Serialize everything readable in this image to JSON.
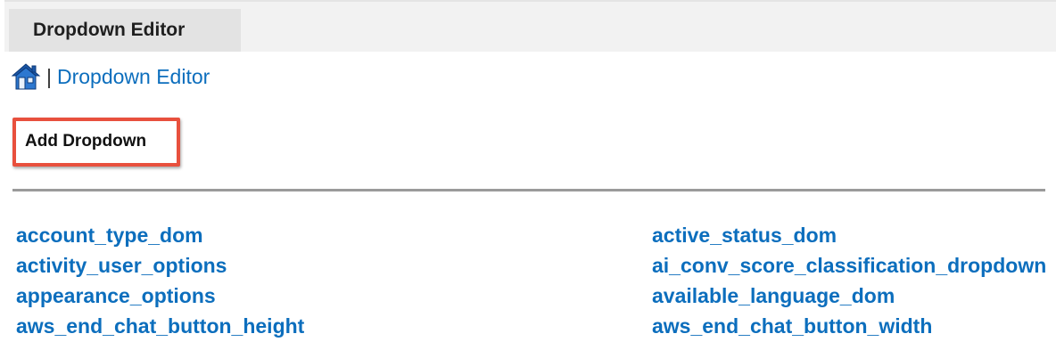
{
  "header": {
    "tab_label": "Dropdown Editor"
  },
  "breadcrumb": {
    "separator": "|",
    "current": "Dropdown Editor",
    "home_icon": "home-icon"
  },
  "actions": {
    "add_label": "Add Dropdown",
    "highlight_color": "#e8503d"
  },
  "dropdowns": {
    "left": [
      "account_type_dom",
      "activity_user_options",
      "appearance_options",
      "aws_end_chat_button_height"
    ],
    "right": [
      "active_status_dom",
      "ai_conv_score_classification_dropdown",
      "available_language_dom",
      "aws_end_chat_button_width"
    ]
  },
  "colors": {
    "link": "#0c6ebd",
    "tab_bg": "#e3e3e3",
    "header_bg": "#f2f2f2"
  }
}
